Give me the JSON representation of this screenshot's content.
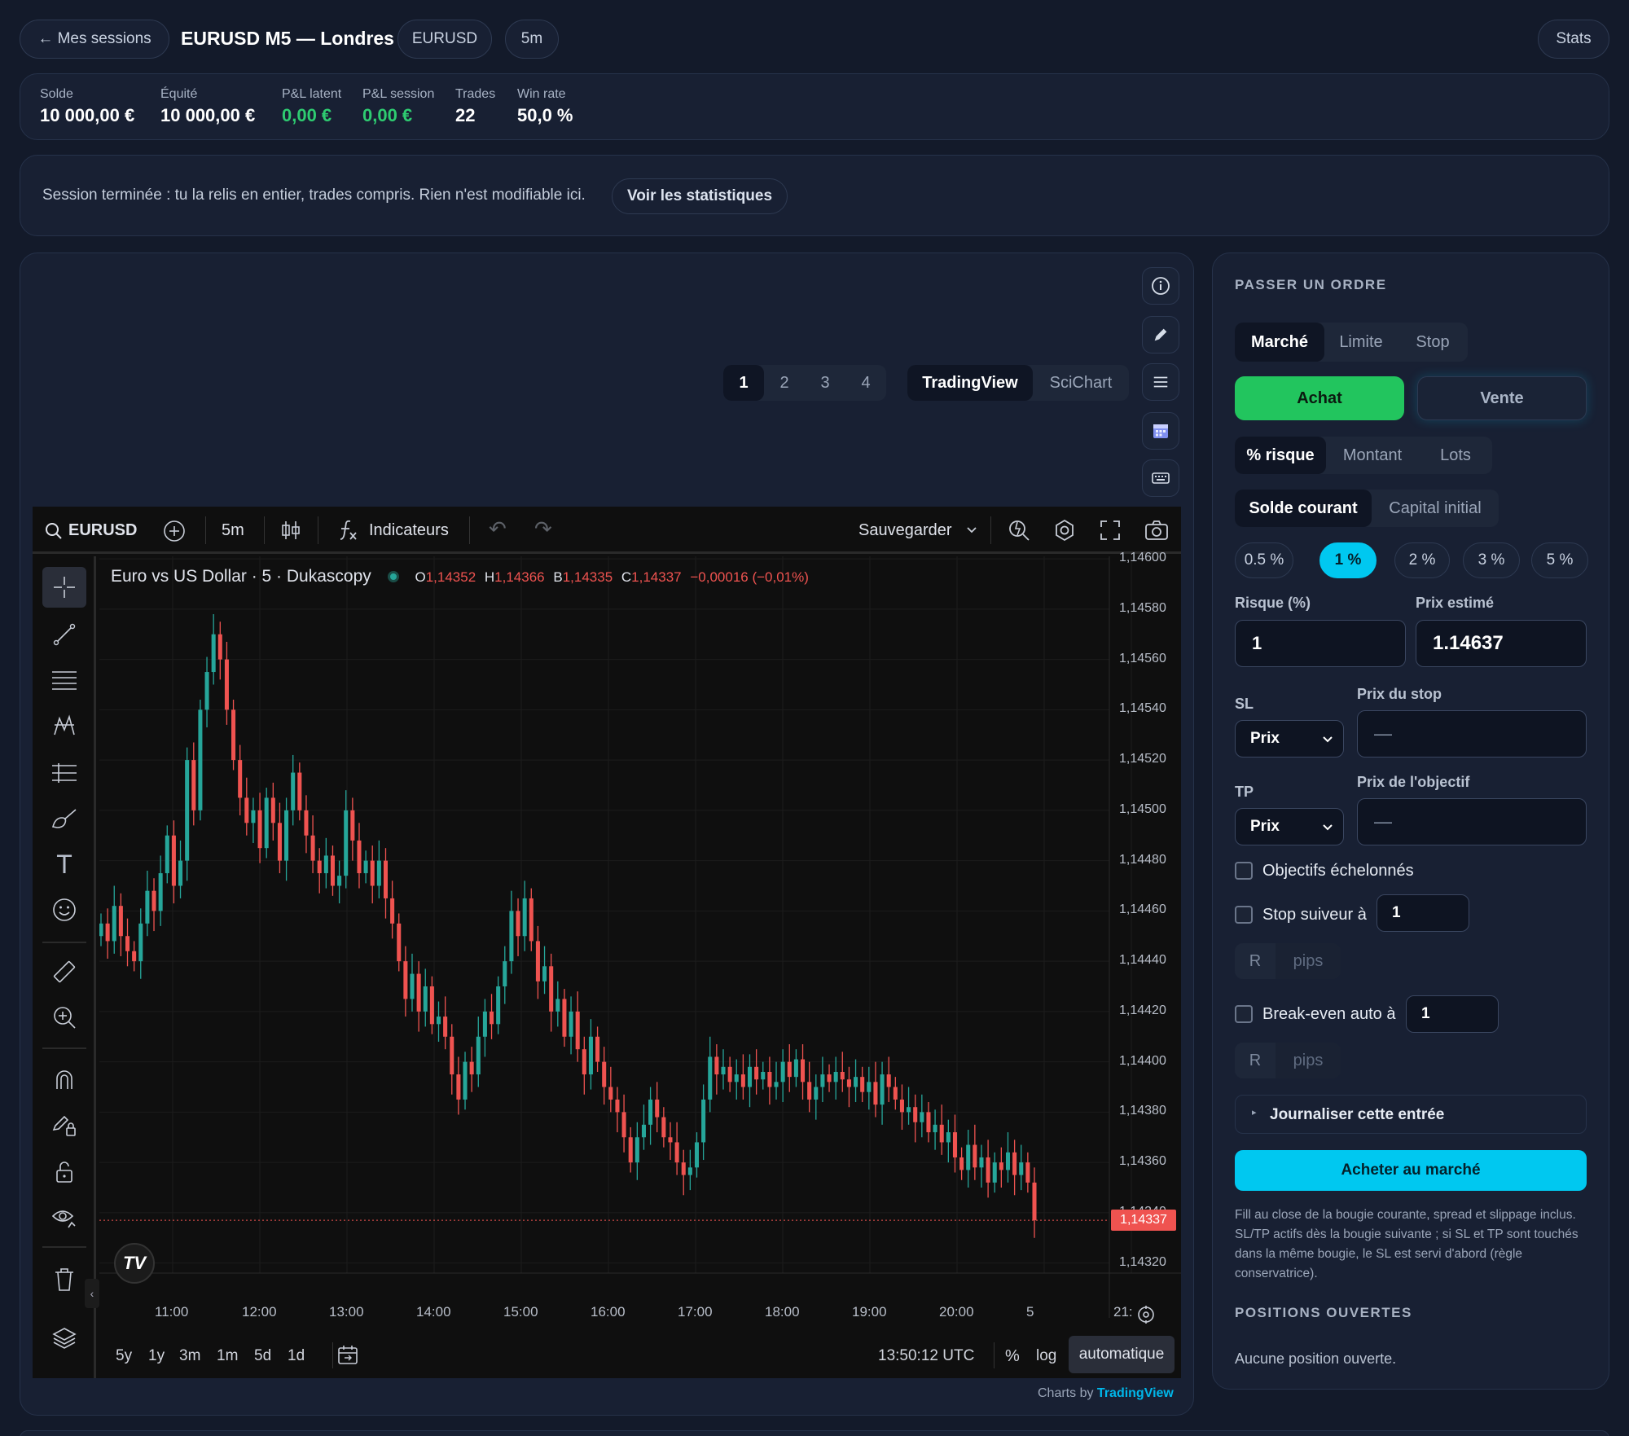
{
  "header": {
    "back_label": "← Mes sessions",
    "title": "EURUSD M5 — Londres",
    "symbol_badge": "EURUSD",
    "tf_badge": "5m",
    "stats_button": "Stats"
  },
  "stats": [
    {
      "label": "Solde",
      "value": "10 000,00 €"
    },
    {
      "label": "Équité",
      "value": "10 000,00 €"
    },
    {
      "label": "P&L latent",
      "value": "0,00 €"
    },
    {
      "label": "P&L session",
      "value": "0,00 €"
    },
    {
      "label": "Trades",
      "value": "22"
    },
    {
      "label": "Win rate",
      "value": "50,0 %"
    }
  ],
  "notice": {
    "text": "Session terminée : tu la relis en entier, trades compris. Rien n'est modifiable ici.",
    "button": "Voir les statistiques"
  },
  "layout_tabs": [
    "1",
    "2",
    "3",
    "4"
  ],
  "engine_tabs": [
    "TradingView",
    "SciChart"
  ],
  "chart_toolbar": {
    "symbol": "EURUSD",
    "interval": "5m",
    "indicators": "Indicateurs",
    "save": "Sauvegarder"
  },
  "chart_legend": {
    "title": "Euro vs US Dollar · 5 · Dukascopy",
    "o_label": "O",
    "o": "1,14352",
    "h_label": "H",
    "h": "1,14366",
    "b_label": "B",
    "b": "1,14335",
    "c_label": "C",
    "c": "1,14337",
    "change": "−0,00016 (−0,01%)"
  },
  "chart_footer": {
    "ranges": [
      "5y",
      "1y",
      "3m",
      "1m",
      "5d",
      "1d"
    ],
    "clock": "13:50:12 UTC",
    "pct": "%",
    "log": "log",
    "auto": "automatique",
    "credit_prefix": "Charts by",
    "credit_brand": "TradingView"
  },
  "chart_data": {
    "type": "candlestick",
    "x_ticks": [
      "11:00",
      "12:00",
      "13:00",
      "14:00",
      "15:00",
      "16:00",
      "17:00",
      "18:00",
      "19:00",
      "20:00",
      "5",
      "21:"
    ],
    "y_ticks": [
      "1,14600",
      "1,14580",
      "1,14560",
      "1,14540",
      "1,14520",
      "1,14500",
      "1,14480",
      "1,14460",
      "1,14440",
      "1,14420",
      "1,14400",
      "1,14380",
      "1,14360",
      "1,14340",
      "1,14320"
    ],
    "ylim": [
      1.14316,
      1.14601
    ],
    "last_price": 1.14337,
    "last_price_label": "1,14337",
    "up_color": "#26a69a",
    "down_color": "#ef5350",
    "close": [
      1.14455,
      1.14448,
      1.14462,
      1.1445,
      1.14444,
      1.1444,
      1.14455,
      1.14468,
      1.1446,
      1.14475,
      1.1449,
      1.1447,
      1.1448,
      1.1452,
      1.145,
      1.1454,
      1.14555,
      1.1457,
      1.1456,
      1.1454,
      1.1452,
      1.14505,
      1.14495,
      1.145,
      1.14485,
      1.14505,
      1.14495,
      1.1448,
      1.145,
      1.14515,
      1.145,
      1.1449,
      1.1448,
      1.14475,
      1.14482,
      1.1447,
      1.14474,
      1.145,
      1.14488,
      1.14475,
      1.1448,
      1.1447,
      1.1448,
      1.14465,
      1.14455,
      1.1444,
      1.14425,
      1.14435,
      1.1442,
      1.1443,
      1.14415,
      1.14418,
      1.1441,
      1.14395,
      1.14385,
      1.144,
      1.14395,
      1.1441,
      1.1442,
      1.14415,
      1.1443,
      1.1444,
      1.1446,
      1.1445,
      1.14465,
      1.14448,
      1.14432,
      1.14438,
      1.1442,
      1.14425,
      1.1441,
      1.1442,
      1.14405,
      1.14395,
      1.1441,
      1.144,
      1.1439,
      1.14385,
      1.1438,
      1.1437,
      1.1436,
      1.1437,
      1.14375,
      1.14385,
      1.14378,
      1.1437,
      1.14368,
      1.1436,
      1.14355,
      1.14358,
      1.14368,
      1.14385,
      1.14402,
      1.14395,
      1.14398,
      1.14392,
      1.14395,
      1.1439,
      1.14398,
      1.14393,
      1.14396,
      1.1439,
      1.14392,
      1.144,
      1.14394,
      1.14401,
      1.14392,
      1.14385,
      1.1439,
      1.14395,
      1.14392,
      1.14396,
      1.14393,
      1.1439,
      1.14394,
      1.14388,
      1.14392,
      1.14383,
      1.14395,
      1.1439,
      1.14385,
      1.1438,
      1.14382,
      1.14376,
      1.1438,
      1.14372,
      1.14375,
      1.14368,
      1.14372,
      1.14362,
      1.14357,
      1.14367,
      1.14358,
      1.14362,
      1.14352,
      1.1436,
      1.14357,
      1.14364,
      1.14355,
      1.1436,
      1.14352,
      1.14337
    ],
    "open_first": 1.1445
  },
  "order_panel": {
    "heading": "PASSER UN ORDRE",
    "order_types": [
      "Marché",
      "Limite",
      "Stop"
    ],
    "buy": "Achat",
    "sell": "Vente",
    "sizing_modes": [
      "% risque",
      "Montant",
      "Lots"
    ],
    "base_modes": [
      "Solde courant",
      "Capital initial"
    ],
    "risk_presets": [
      "0.5 %",
      "1 %",
      "2 %",
      "3 %",
      "5 %"
    ],
    "risk_label": "Risque (%)",
    "risk_value": "1",
    "est_price_label": "Prix estimé",
    "est_price": "1.14637",
    "sl_label": "SL",
    "sl_mode": "Prix",
    "sl_price_label": "Prix du stop",
    "sl_placeholder": "—",
    "tp_label": "TP",
    "tp_mode": "Prix",
    "tp_price_label": "Prix de l'objectif",
    "tp_placeholder": "—",
    "scaled_label": "Objectifs échelonnés",
    "trailing_label": "Stop suiveur à",
    "trailing_value": "1",
    "unit_r": "R",
    "unit_pips": "pips",
    "breakeven_label": "Break-even auto à",
    "breakeven_value": "1",
    "journal_label": "Journaliser cette entrée",
    "submit": "Acheter au marché",
    "fill_note": "Fill au close de la bougie courante, spread et slippage inclus. SL/TP actifs dès la bougie suivante ; si SL et TP sont touchés dans la même bougie, le SL est servi d'abord (règle conservatrice).",
    "positions_heading": "POSITIONS OUVERTES",
    "positions_empty": "Aucune position ouverte."
  },
  "colors": {
    "accent_cyan": "#00c8f0",
    "buy_green": "#22c55e",
    "pnl_green": "#2ecc71"
  }
}
